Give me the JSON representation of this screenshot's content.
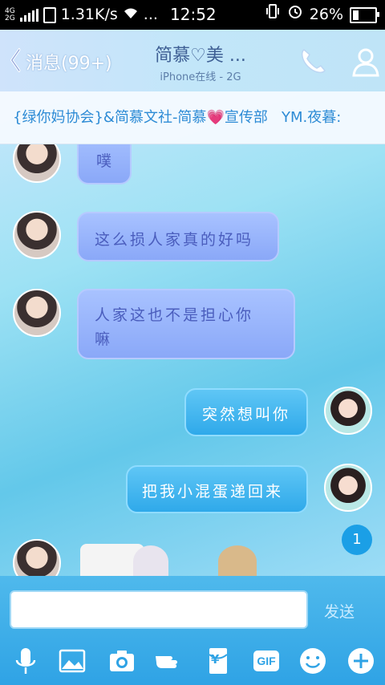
{
  "status_bar": {
    "net_top": "4G",
    "net_bottom": "2G",
    "speed": "1.31K/s",
    "more": "...",
    "time": "12:52",
    "battery": "26%",
    "battery_level": 0.26
  },
  "header": {
    "back_label": "消息(99+)",
    "title": "简慕♡美 ...",
    "subtitle": "iPhone在线 - 2G"
  },
  "banner": {
    "part1": "{绿你妈协会}&简慕文社-简慕",
    "part2": "宣传部",
    "part3": "YM.夜暮:"
  },
  "messages": [
    {
      "side": "in",
      "text": "噗"
    },
    {
      "side": "in",
      "text": "这么损人家真的好吗"
    },
    {
      "side": "in",
      "text_line1": "人家这也不是担心你",
      "text_line2": "嘛"
    },
    {
      "side": "out",
      "text": "突然想叫你"
    },
    {
      "side": "out",
      "text": "把我小混蛋递回来"
    }
  ],
  "unread_count": "1",
  "input": {
    "placeholder": "",
    "send_label": "发送"
  },
  "toolbar": {
    "gif": "GIF",
    "yen": "¥"
  },
  "colors": {
    "accent": "#2fa3e5",
    "bubble_in": "#8aa8f8",
    "bubble_out": "#2fa9ea"
  }
}
